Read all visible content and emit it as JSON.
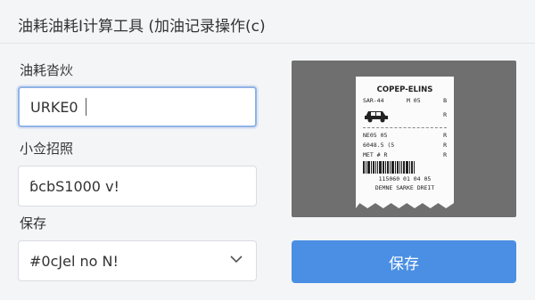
{
  "header": {
    "title": "油耗油耗I计算工具 (加油记录操作(c)"
  },
  "form": {
    "field1": {
      "label": "油耗沓炏",
      "value": "URKE0"
    },
    "field2": {
      "label": "小佥招照",
      "value": "ɓcbS1000 v!"
    },
    "field3": {
      "label": "保存",
      "value": "#0cJel no N!"
    }
  },
  "receipt": {
    "title": "COPEP-ELINS",
    "row1_left": "SAR-44",
    "row1_mid": "M 05",
    "row1_right": "B",
    "car_right": "R",
    "row2_left": "NE05 05",
    "row2_right": "R",
    "row3_left": "6048.5 (5",
    "row3_right": "R",
    "row4_left": "MET # R",
    "row4_right": "R",
    "barcode_number": "115060 01 04 05",
    "footer": "DEMNE SARKE DREIT"
  },
  "actions": {
    "save_label": "保存"
  },
  "icons": {
    "chevron": "chevron-down-icon",
    "car": "car-icon",
    "barcode": "barcode-icon"
  },
  "colors": {
    "accent": "#4a8fe3",
    "focus_border": "#8fb3e6",
    "panel_bg": "#6f6f6f"
  }
}
